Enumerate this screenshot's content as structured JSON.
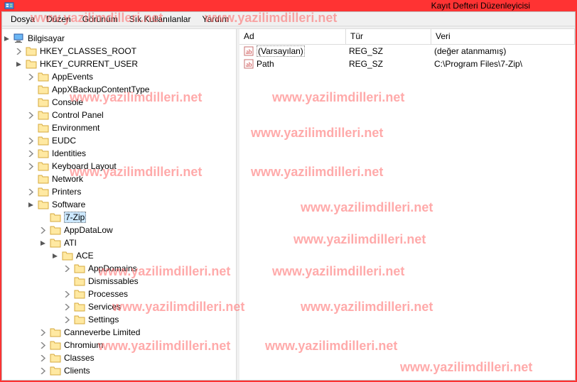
{
  "window": {
    "title": "Kayıt Defteri Düzenleyicisi"
  },
  "menu": {
    "file": "Dosya",
    "edit": "Düzen",
    "view": "Görünüm",
    "favorites": "Sık Kullanılanlar",
    "help": "Yardım"
  },
  "columns": {
    "name": "Ad",
    "type": "Tür",
    "data": "Veri"
  },
  "values": [
    {
      "name": "(Varsayılan)",
      "type": "REG_SZ",
      "data": "(değer atanmamış)",
      "selected": true
    },
    {
      "name": "Path",
      "type": "REG_SZ",
      "data": "C:\\Program Files\\7-Zip\\",
      "selected": false
    }
  ],
  "tree": {
    "root": "Bilgisayar",
    "hkcr": "HKEY_CLASSES_ROOT",
    "hkcu": "HKEY_CURRENT_USER",
    "hkcu_children": {
      "appevents": "AppEvents",
      "appxbackup": "AppXBackupContentType",
      "console": "Console",
      "controlpanel": "Control Panel",
      "environment": "Environment",
      "eudc": "EUDC",
      "identities": "Identities",
      "keyboard": "Keyboard Layout",
      "network": "Network",
      "printers": "Printers",
      "software": "Software"
    },
    "software_children": {
      "sevenzip": "7-Zip",
      "appdatalow": "AppDataLow",
      "ati": "ATI",
      "canneverbe": "Canneverbe Limited",
      "chromium": "Chromium",
      "classes": "Classes",
      "clients": "Clients"
    },
    "ati_children": {
      "ace": "ACE"
    },
    "ace_children": {
      "appdomains": "AppDomains",
      "dismissables": "Dismissables",
      "processes": "Processes",
      "services": "Services",
      "settings": "Settings"
    }
  },
  "watermark": "www.yazilimdilleri.net",
  "icons": {
    "computer": "computer-icon",
    "folder": "folder-icon",
    "string": "string-value-icon"
  }
}
